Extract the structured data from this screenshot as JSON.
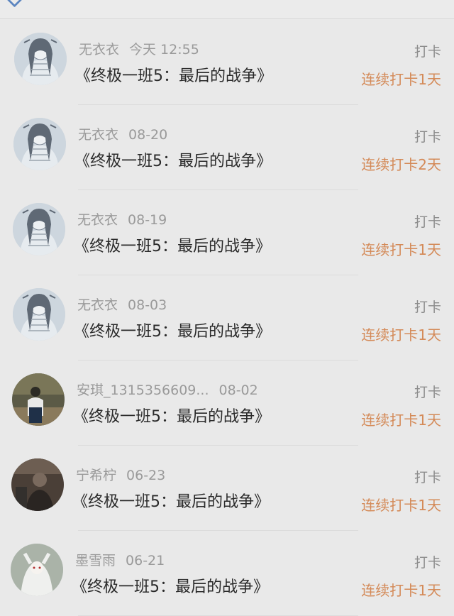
{
  "header": {
    "search_icon": "search-icon"
  },
  "records": [
    {
      "user": "无衣衣",
      "date": "今天 12:55",
      "book": "《终极一班5：最后的战争》",
      "type": "打卡",
      "streak": "连续打卡1天",
      "avatar": "anime-girl"
    },
    {
      "user": "无衣衣",
      "date": "08-20",
      "book": "《终极一班5：最后的战争》",
      "type": "打卡",
      "streak": "连续打卡2天",
      "avatar": "anime-girl"
    },
    {
      "user": "无衣衣",
      "date": "08-19",
      "book": "《终极一班5：最后的战争》",
      "type": "打卡",
      "streak": "连续打卡1天",
      "avatar": "anime-girl"
    },
    {
      "user": "无衣衣",
      "date": "08-03",
      "book": "《终极一班5：最后的战争》",
      "type": "打卡",
      "streak": "连续打卡1天",
      "avatar": "anime-girl"
    },
    {
      "user": "安琪_1315356609...",
      "date": "08-02",
      "book": "《终极一班5：最后的战争》",
      "type": "打卡",
      "streak": "连续打卡1天",
      "avatar": "photo-outdoor"
    },
    {
      "user": "宁希柠",
      "date": "06-23",
      "book": "《终极一班5：最后的战争》",
      "type": "打卡",
      "streak": "连续打卡1天",
      "avatar": "photo-dark"
    },
    {
      "user": "墨雪雨",
      "date": "06-21",
      "book": "《终极一班5：最后的战争》",
      "type": "打卡",
      "streak": "连续打卡1天",
      "avatar": "anime-white"
    }
  ],
  "colors": {
    "streak": "#d48a58",
    "meta": "#9a9a9a",
    "title": "#2a2a2a",
    "background": "#e9e9e9"
  }
}
